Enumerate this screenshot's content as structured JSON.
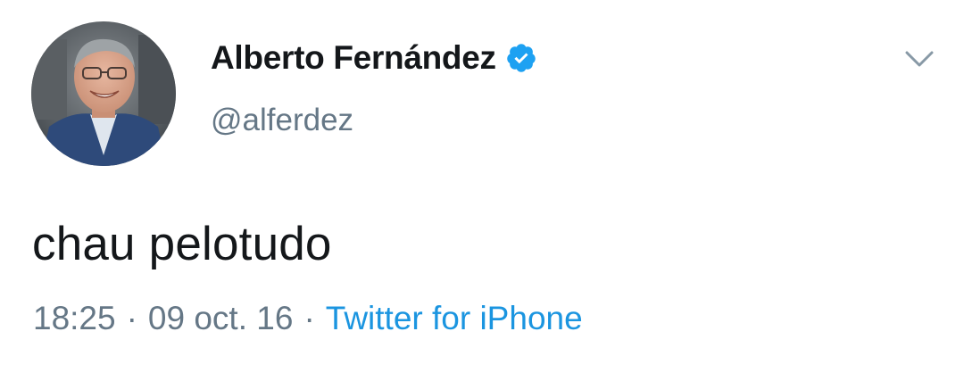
{
  "user": {
    "display_name": "Alberto Fernández",
    "handle": "@alferdez",
    "verified": true,
    "avatar_icon": "profile-photo"
  },
  "tweet": {
    "text": "chau pelotudo"
  },
  "meta": {
    "time": "18:25",
    "separator": "·",
    "date": "09 oct. 16",
    "source": "Twitter for iPhone"
  },
  "menu": {
    "icon": "chevron-down-icon"
  },
  "colors": {
    "text_primary": "#14171a",
    "text_secondary": "#657786",
    "link": "#1b95e0",
    "verified_badge": "#1da1f2"
  }
}
